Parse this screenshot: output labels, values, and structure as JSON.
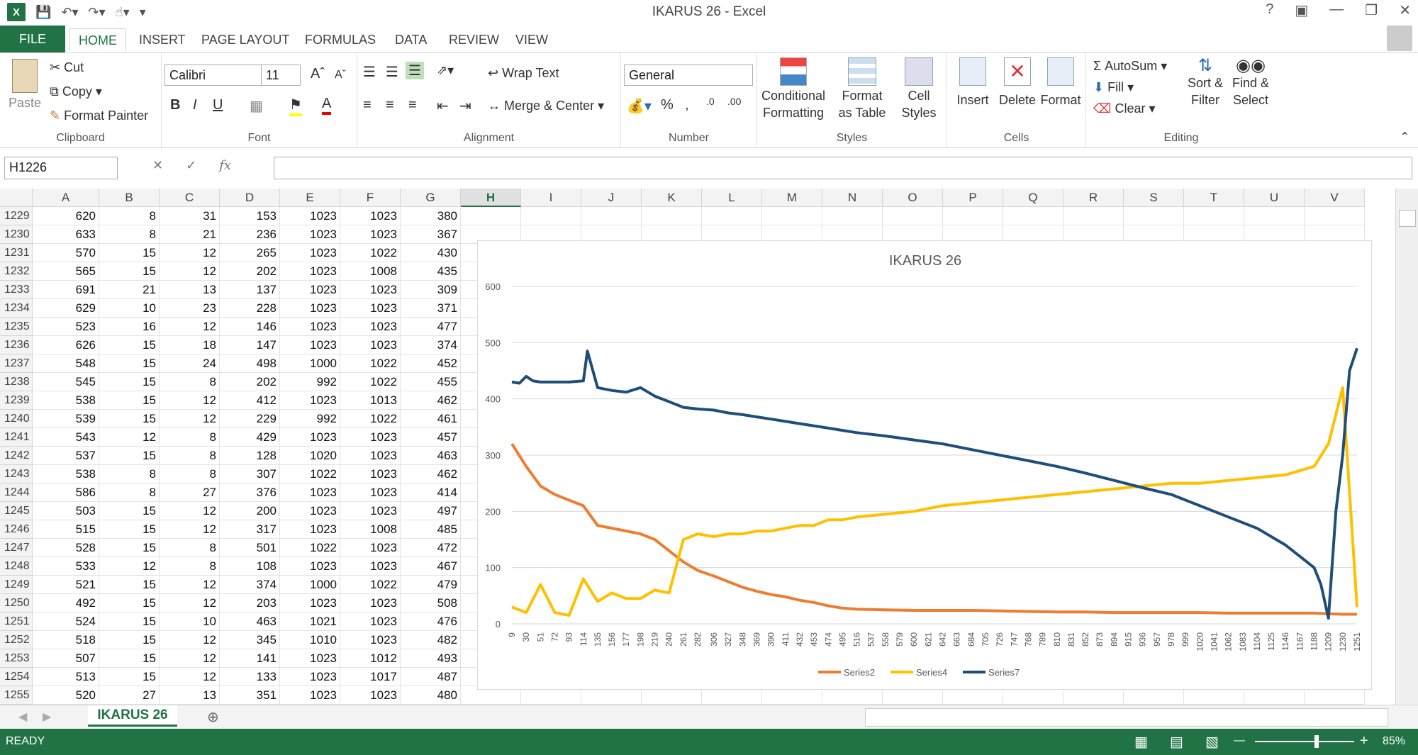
{
  "window": {
    "title": "IKARUS 26 - Excel"
  },
  "qat": {
    "save": "save-icon",
    "undo": "undo-icon",
    "redo": "redo-icon"
  },
  "tabs": [
    "FILE",
    "HOME",
    "INSERT",
    "PAGE LAYOUT",
    "FORMULAS",
    "DATA",
    "REVIEW",
    "VIEW"
  ],
  "ribbon": {
    "clipboard": {
      "paste": "Paste",
      "cut": "Cut",
      "copy": "Copy",
      "format_painter": "Format Painter",
      "label": "Clipboard"
    },
    "font": {
      "name": "Calibri",
      "size": "11",
      "label": "Font"
    },
    "alignment": {
      "wrap": "Wrap Text",
      "merge": "Merge & Center",
      "label": "Alignment"
    },
    "number": {
      "format": "General",
      "label": "Number"
    },
    "styles": {
      "conditional": "Conditional Formatting",
      "format_table": "Format as Table",
      "cell_styles": "Cell Styles",
      "label": "Styles"
    },
    "cells": {
      "insert": "Insert",
      "delete": "Delete",
      "format": "Format",
      "label": "Cells"
    },
    "editing": {
      "autosum": "AutoSum",
      "fill": "Fill",
      "clear": "Clear",
      "sort": "Sort & Filter",
      "find": "Find & Select",
      "label": "Editing"
    }
  },
  "formula_bar": {
    "name_box": "H1226",
    "fx": "fx",
    "value": ""
  },
  "columns": [
    "A",
    "B",
    "C",
    "D",
    "E",
    "F",
    "G",
    "H",
    "I",
    "J",
    "K",
    "L",
    "M",
    "N",
    "O",
    "P",
    "Q",
    "R",
    "S",
    "T",
    "U",
    "V"
  ],
  "rows": [
    [
      "1229",
      "620",
      "8",
      "31",
      "153",
      "1023",
      "1023",
      "380"
    ],
    [
      "1230",
      "633",
      "8",
      "21",
      "236",
      "1023",
      "1023",
      "367"
    ],
    [
      "1231",
      "570",
      "15",
      "12",
      "265",
      "1023",
      "1022",
      "430"
    ],
    [
      "1232",
      "565",
      "15",
      "12",
      "202",
      "1023",
      "1008",
      "435"
    ],
    [
      "1233",
      "691",
      "21",
      "13",
      "137",
      "1023",
      "1023",
      "309"
    ],
    [
      "1234",
      "629",
      "10",
      "23",
      "228",
      "1023",
      "1023",
      "371"
    ],
    [
      "1235",
      "523",
      "16",
      "12",
      "146",
      "1023",
      "1023",
      "477"
    ],
    [
      "1236",
      "626",
      "15",
      "18",
      "147",
      "1023",
      "1023",
      "374"
    ],
    [
      "1237",
      "548",
      "15",
      "24",
      "498",
      "1000",
      "1022",
      "452"
    ],
    [
      "1238",
      "545",
      "15",
      "8",
      "202",
      "992",
      "1022",
      "455"
    ],
    [
      "1239",
      "538",
      "15",
      "12",
      "412",
      "1023",
      "1013",
      "462"
    ],
    [
      "1240",
      "539",
      "15",
      "12",
      "229",
      "992",
      "1022",
      "461"
    ],
    [
      "1241",
      "543",
      "12",
      "8",
      "429",
      "1023",
      "1023",
      "457"
    ],
    [
      "1242",
      "537",
      "15",
      "8",
      "128",
      "1020",
      "1023",
      "463"
    ],
    [
      "1243",
      "538",
      "8",
      "8",
      "307",
      "1022",
      "1023",
      "462"
    ],
    [
      "1244",
      "586",
      "8",
      "27",
      "376",
      "1023",
      "1023",
      "414"
    ],
    [
      "1245",
      "503",
      "15",
      "12",
      "200",
      "1023",
      "1023",
      "497"
    ],
    [
      "1246",
      "515",
      "15",
      "12",
      "317",
      "1023",
      "1008",
      "485"
    ],
    [
      "1247",
      "528",
      "15",
      "8",
      "501",
      "1022",
      "1023",
      "472"
    ],
    [
      "1248",
      "533",
      "12",
      "8",
      "108",
      "1023",
      "1023",
      "467"
    ],
    [
      "1249",
      "521",
      "15",
      "12",
      "374",
      "1000",
      "1022",
      "479"
    ],
    [
      "1250",
      "492",
      "15",
      "12",
      "203",
      "1023",
      "1023",
      "508"
    ],
    [
      "1251",
      "524",
      "15",
      "10",
      "463",
      "1021",
      "1023",
      "476"
    ],
    [
      "1252",
      "518",
      "15",
      "12",
      "345",
      "1010",
      "1023",
      "482"
    ],
    [
      "1253",
      "507",
      "15",
      "12",
      "141",
      "1023",
      "1012",
      "493"
    ],
    [
      "1254",
      "513",
      "15",
      "12",
      "133",
      "1023",
      "1017",
      "487"
    ],
    [
      "1255",
      "520",
      "27",
      "13",
      "351",
      "1023",
      "1023",
      "480"
    ]
  ],
  "sheet": {
    "name": "IKARUS 26"
  },
  "status": {
    "mode": "READY",
    "zoom": "85%"
  },
  "chart_data": {
    "type": "line",
    "title": "IKARUS 26",
    "ylim": [
      0,
      600
    ],
    "yticks": [
      0,
      100,
      200,
      300,
      400,
      500,
      600
    ],
    "xlim": [
      9,
      1251
    ],
    "xticks": [
      9,
      30,
      51,
      72,
      93,
      114,
      135,
      156,
      177,
      198,
      219,
      240,
      261,
      282,
      306,
      327,
      348,
      369,
      390,
      411,
      432,
      453,
      474,
      495,
      516,
      537,
      558,
      579,
      600,
      621,
      642,
      663,
      684,
      705,
      726,
      747,
      768,
      789,
      810,
      831,
      852,
      873,
      894,
      915,
      936,
      957,
      978,
      999,
      1020,
      1041,
      1062,
      1083,
      1104,
      1125,
      1146,
      1167,
      1188,
      1209,
      1230,
      1251
    ],
    "legend": "bottom",
    "series": [
      {
        "name": "Series2",
        "color": "#ED7D31",
        "x": [
          9,
          30,
          51,
          72,
          93,
          114,
          135,
          156,
          177,
          198,
          219,
          240,
          261,
          282,
          306,
          327,
          348,
          369,
          390,
          411,
          432,
          453,
          474,
          495,
          516,
          558,
          600,
          642,
          684,
          726,
          768,
          810,
          852,
          894,
          936,
          978,
          1020,
          1062,
          1104,
          1146,
          1188,
          1209,
          1230,
          1251
        ],
        "y": [
          320,
          280,
          245,
          230,
          220,
          210,
          175,
          170,
          165,
          160,
          150,
          130,
          110,
          95,
          85,
          75,
          65,
          58,
          52,
          48,
          42,
          38,
          32,
          28,
          26,
          25,
          24,
          24,
          24,
          23,
          22,
          21,
          21,
          20,
          20,
          20,
          20,
          19,
          19,
          19,
          19,
          18,
          17,
          17
        ]
      },
      {
        "name": "Series4",
        "color": "#FFC000",
        "x": [
          9,
          30,
          51,
          72,
          93,
          114,
          135,
          156,
          177,
          198,
          219,
          240,
          261,
          282,
          306,
          327,
          348,
          369,
          390,
          411,
          432,
          453,
          474,
          495,
          516,
          558,
          600,
          642,
          684,
          726,
          768,
          810,
          852,
          894,
          936,
          978,
          1020,
          1062,
          1104,
          1146,
          1188,
          1209,
          1230,
          1251
        ],
        "y": [
          30,
          20,
          70,
          20,
          15,
          80,
          40,
          55,
          45,
          45,
          60,
          55,
          150,
          160,
          155,
          160,
          160,
          165,
          165,
          170,
          175,
          175,
          185,
          185,
          190,
          195,
          200,
          210,
          215,
          220,
          225,
          230,
          235,
          240,
          245,
          250,
          250,
          255,
          260,
          265,
          280,
          320,
          420,
          30
        ]
      },
      {
        "name": "Series7",
        "color": "#1F4E79",
        "x": [
          9,
          20,
          30,
          40,
          51,
          72,
          93,
          114,
          120,
          135,
          156,
          177,
          198,
          219,
          240,
          261,
          282,
          306,
          327,
          348,
          369,
          390,
          411,
          432,
          453,
          474,
          495,
          516,
          558,
          600,
          642,
          684,
          726,
          768,
          810,
          852,
          894,
          936,
          978,
          1020,
          1062,
          1104,
          1146,
          1167,
          1188,
          1198,
          1209,
          1220,
          1230,
          1240,
          1251
        ],
        "y": [
          430,
          428,
          440,
          432,
          430,
          430,
          430,
          432,
          485,
          420,
          415,
          412,
          420,
          405,
          395,
          385,
          382,
          380,
          375,
          372,
          368,
          364,
          360,
          356,
          352,
          348,
          344,
          340,
          334,
          327,
          320,
          310,
          300,
          290,
          280,
          268,
          255,
          242,
          230,
          210,
          190,
          170,
          140,
          120,
          100,
          70,
          10,
          200,
          300,
          450,
          490
        ]
      }
    ]
  }
}
